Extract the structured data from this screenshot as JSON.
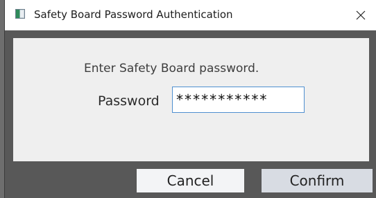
{
  "window": {
    "title": "Safety Board Password Authentication",
    "app_icon": "app-window-icon",
    "close_icon": "close-icon"
  },
  "dialog": {
    "prompt": "Enter Safety Board password.",
    "password_label": "Password",
    "password_value": "***********"
  },
  "buttons": {
    "cancel": "Cancel",
    "confirm": "Confirm"
  },
  "colors": {
    "content_bg": "#efefef",
    "input_border": "#4e8fd0",
    "dialog_frame": "#585858"
  }
}
